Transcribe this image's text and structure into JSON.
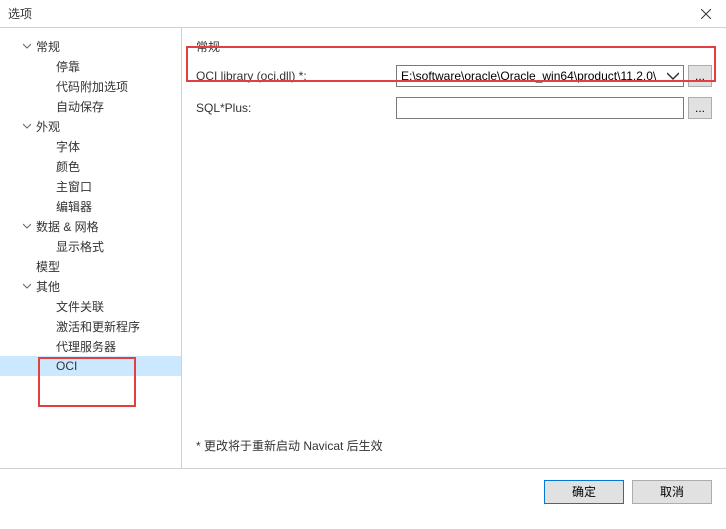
{
  "window": {
    "title": "选项"
  },
  "tree": {
    "general": {
      "label": "常规",
      "expanded": true
    },
    "general_children": [
      {
        "label": "停靠"
      },
      {
        "label": "代码附加选项"
      },
      {
        "label": "自动保存"
      }
    ],
    "appearance": {
      "label": "外观",
      "expanded": true
    },
    "appearance_children": [
      {
        "label": "字体"
      },
      {
        "label": "颜色"
      },
      {
        "label": "主窗口"
      },
      {
        "label": "编辑器"
      }
    ],
    "datagrid": {
      "label": "数据 & 网格",
      "expanded": true
    },
    "datagrid_children": [
      {
        "label": "显示格式"
      }
    ],
    "model": {
      "label": "模型"
    },
    "other": {
      "label": "其他",
      "expanded": true
    },
    "other_children": [
      {
        "label": "文件关联"
      },
      {
        "label": "激活和更新程序"
      },
      {
        "label": "代理服务器"
      },
      {
        "label": "OCI",
        "selected": true
      }
    ]
  },
  "main": {
    "section_title": "常规",
    "oci_label": "OCI library (oci.dll) *:",
    "oci_value": "E:\\software\\oracle\\Oracle_win64\\product\\11.2.0\\",
    "sqlplus_label": "SQL*Plus:",
    "sqlplus_value": "",
    "note": "* 更改将于重新启动 Navicat 后生效"
  },
  "footer": {
    "ok": "确定",
    "cancel": "取消"
  }
}
